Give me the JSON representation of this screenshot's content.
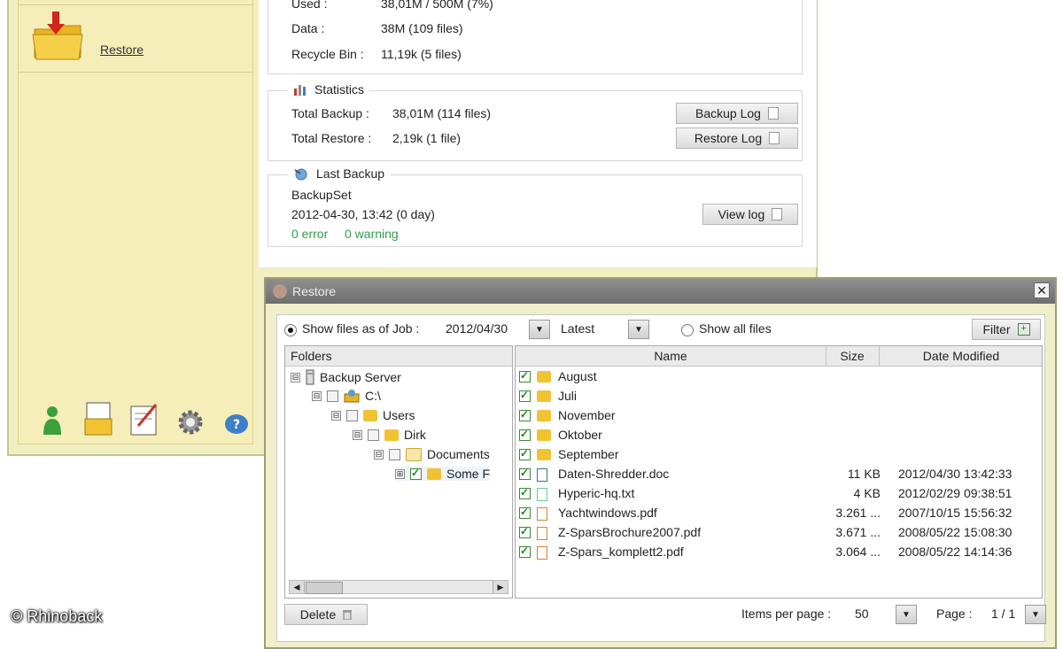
{
  "sidebar": {
    "restore_label": "Restore"
  },
  "summary": {
    "used_label": "Used :",
    "used_value": "38,01M / 500M (7%)",
    "data_label": "Data :",
    "data_value": "38M  (109 files)",
    "recycle_label": "Recycle Bin :",
    "recycle_value": "11,19k  (5 files)"
  },
  "statistics": {
    "title": "Statistics",
    "total_backup_label": "Total Backup :",
    "total_backup_value": "38,01M  (114 files)",
    "total_restore_label": "Total Restore :",
    "total_restore_value": "2,19k  (1 file)",
    "backup_log_button": "Backup Log",
    "restore_log_button": "Restore Log"
  },
  "last_backup": {
    "title": "Last Backup",
    "set_name": "BackupSet",
    "datetime": "2012-04-30, 13:42 (0 day)",
    "errors": "0 error",
    "warnings": "0 warning",
    "view_log_button": "View log"
  },
  "restore_dialog": {
    "title": "Restore",
    "close_glyph": "✕",
    "show_as_of_job_label": "Show files as of Job :",
    "job_date": "2012/04/30",
    "job_version": "Latest",
    "show_all_files_label": "Show all files",
    "filter_button": "Filter",
    "folders_header": "Folders",
    "tree": [
      {
        "label": "Backup Server",
        "toggle": "⊟"
      },
      {
        "label": "C:\\",
        "toggle": "⊟"
      },
      {
        "label": "Users",
        "toggle": "⊟"
      },
      {
        "label": "Dirk",
        "toggle": "⊟"
      },
      {
        "label": "Documents",
        "toggle": "⊟"
      },
      {
        "label": "Some F",
        "toggle": "⊞"
      }
    ],
    "columns": {
      "name": "Name",
      "size": "Size",
      "date": "Date Modified"
    },
    "files": [
      {
        "name": "August",
        "size": "",
        "date": "",
        "type": "folder"
      },
      {
        "name": "Juli",
        "size": "",
        "date": "",
        "type": "folder"
      },
      {
        "name": "November",
        "size": "",
        "date": "",
        "type": "folder"
      },
      {
        "name": "Oktober",
        "size": "",
        "date": "",
        "type": "folder"
      },
      {
        "name": "September",
        "size": "",
        "date": "",
        "type": "folder"
      },
      {
        "name": "Daten-Shredder.doc",
        "size": "11 KB",
        "date": "2012/04/30 13:42:33",
        "type": "doc"
      },
      {
        "name": "Hyperic-hq.txt",
        "size": "4 KB",
        "date": "2012/02/29 09:38:51",
        "type": "txt"
      },
      {
        "name": "Yachtwindows.pdf",
        "size": "3.261 ...",
        "date": "2007/10/15 15:56:32",
        "type": "pdf"
      },
      {
        "name": "Z-SparsBrochure2007.pdf",
        "size": "3.671 ...",
        "date": "2008/05/22 15:08:30",
        "type": "pdf"
      },
      {
        "name": "Z-Spars_komplett2.pdf",
        "size": "3.064 ...",
        "date": "2008/05/22 14:14:36",
        "type": "pdf"
      }
    ],
    "delete_button": "Delete",
    "items_per_page_label": "Items per page :",
    "items_per_page_value": "50",
    "page_label": "Page :",
    "page_value": "1 / 1"
  },
  "watermark": "© Rhinoback"
}
